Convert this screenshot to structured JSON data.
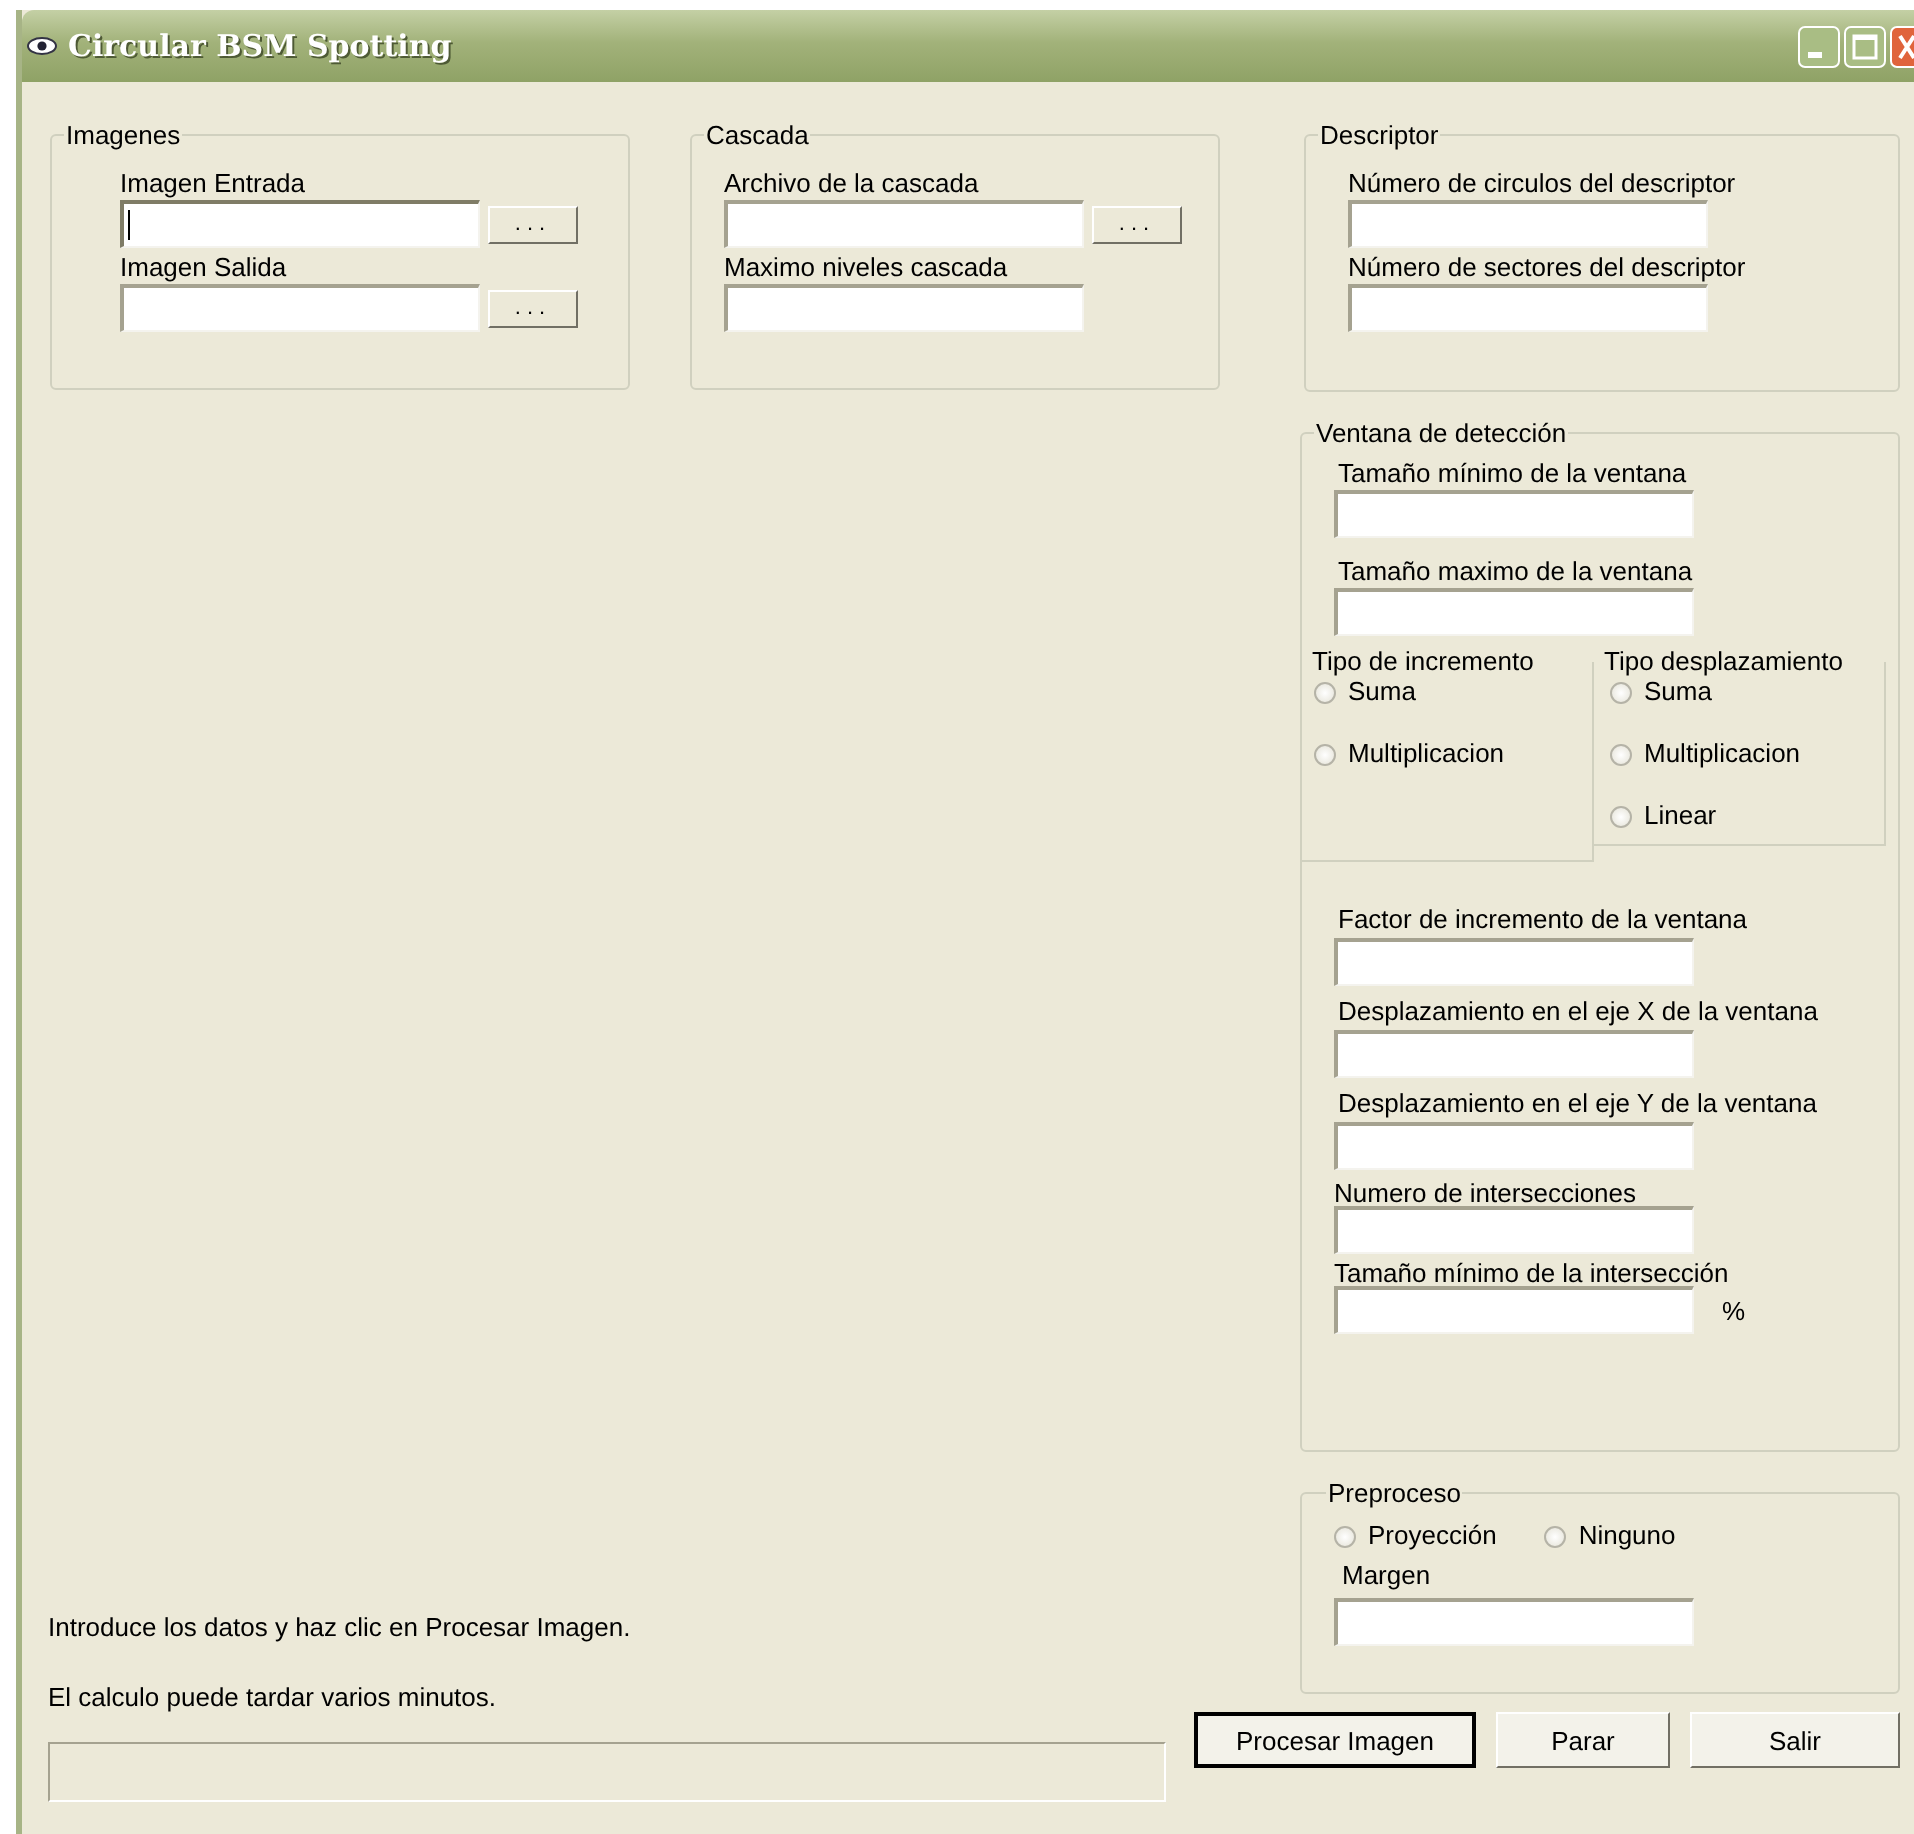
{
  "window": {
    "title": "Circular BSM Spotting"
  },
  "imagenes": {
    "title": "Imagenes",
    "fields": [
      {
        "label": "Imagen Entrada",
        "focused": true,
        "browse": "..."
      },
      {
        "label": "Imagen Salida",
        "focused": false,
        "browse": "..."
      }
    ]
  },
  "cascada": {
    "title": "Cascada",
    "fields": [
      {
        "label": "Archivo de la cascada",
        "focused": false,
        "browse": "..."
      },
      {
        "label": "Maximo niveles cascada",
        "focused": false
      }
    ]
  },
  "descriptor": {
    "title": "Descriptor",
    "fields": [
      {
        "label": "Número de circulos del descriptor",
        "focused": false
      },
      {
        "label": "Número de sectores del descriptor",
        "focused": false
      }
    ]
  },
  "ventana": {
    "title": "Ventana de detección",
    "fields_top": [
      {
        "label": "Tamaño mínimo de la ventana",
        "focused": false
      },
      {
        "label": "Tamaño maximo de la ventana",
        "focused": false
      }
    ],
    "increment": {
      "title": "Tipo de incremento",
      "options": [
        {
          "label": "Suma",
          "selected": false
        },
        {
          "label": "Multiplicacion",
          "selected": false
        }
      ]
    },
    "displacement": {
      "title": "Tipo desplazamiento",
      "options": [
        {
          "label": "Suma",
          "selected": false
        },
        {
          "label": "Multiplicacion",
          "selected": false
        },
        {
          "label": "Linear",
          "selected": false
        }
      ]
    },
    "fields_bottom": [
      {
        "label": "Factor de incremento de la ventana",
        "focused": false
      },
      {
        "label": "Desplazamiento en el eje X de la ventana",
        "focused": false
      },
      {
        "label": "Desplazamiento en el eje Y de la ventana",
        "focused": false
      },
      {
        "label": "Numero de intersecciones",
        "focused": false
      },
      {
        "label": "Tamaño mínimo de la intersección",
        "focused": false,
        "suffix": "%"
      }
    ]
  },
  "preproceso": {
    "title": "Preproceso",
    "options": [
      {
        "label": "Proyección",
        "selected": false
      },
      {
        "label": "Ninguno",
        "selected": false
      }
    ],
    "fields": [
      {
        "label": "Margen",
        "focused": false
      }
    ]
  },
  "messages": [
    "Introduce los datos y haz clic en Procesar Imagen.",
    "El calculo puede tardar varios minutos."
  ],
  "progress": {
    "level": 0
  },
  "buttons": [
    {
      "label": "Procesar Imagen",
      "default": true
    },
    {
      "label": "Parar",
      "default": false
    },
    {
      "label": "Salir",
      "default": false
    }
  ]
}
